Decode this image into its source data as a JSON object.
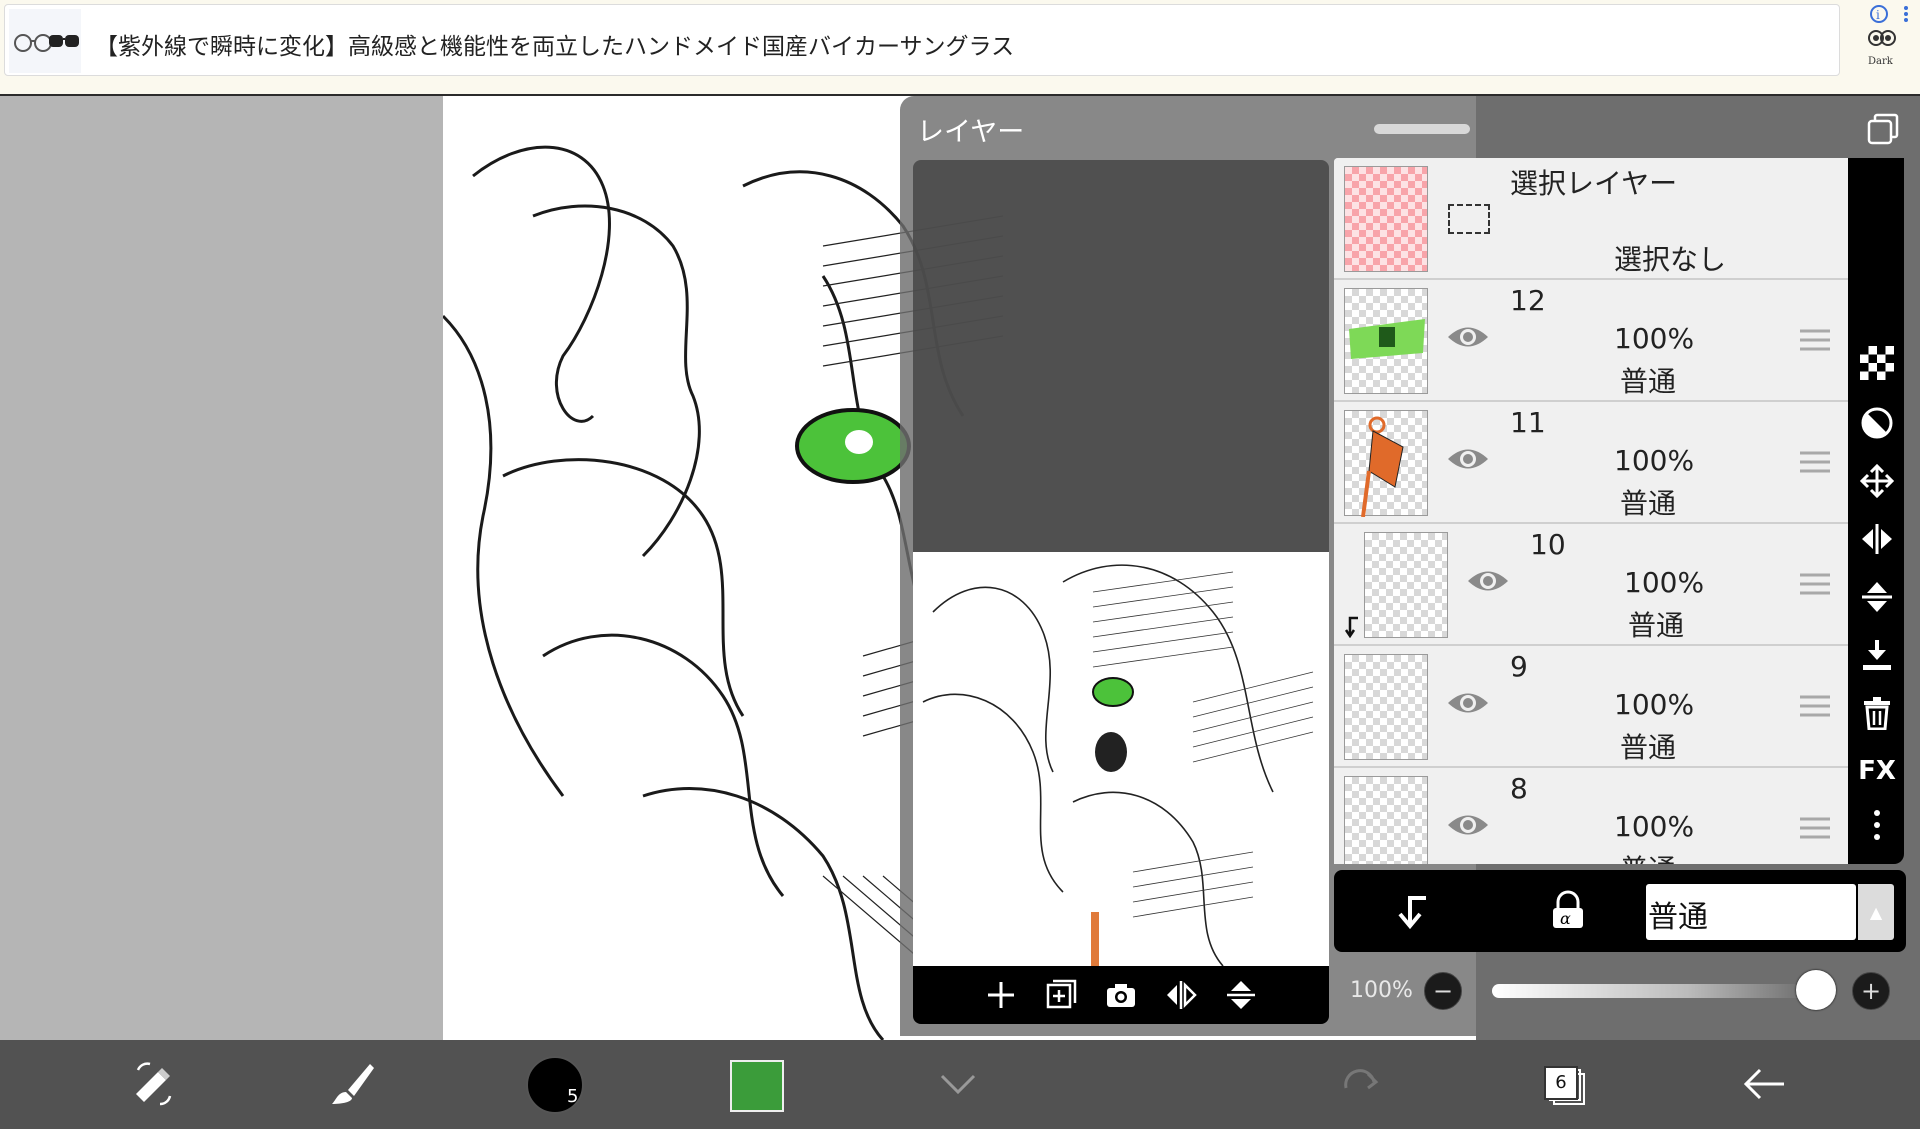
{
  "ad": {
    "text": "【紫外線で瞬時に変化】高級感と機能性を両立したハンドメイド国産バイカーサングラス",
    "side_label": "Dark"
  },
  "layer_panel": {
    "title": "レイヤー",
    "selection_layer": {
      "title": "選択レイヤー",
      "status": "選択なし"
    },
    "layers": [
      {
        "name": "12",
        "opacity": "100%",
        "blend": "普通"
      },
      {
        "name": "11",
        "opacity": "100%",
        "blend": "普通"
      },
      {
        "name": "10",
        "opacity": "100%",
        "blend": "普通"
      },
      {
        "name": "9",
        "opacity": "100%",
        "blend": "普通"
      },
      {
        "name": "8",
        "opacity": "100%",
        "blend": "普通"
      }
    ],
    "blend_mode": "普通",
    "opacity_label": "100%",
    "opacity_value": 1.0,
    "right_toolbar_fx": "FX"
  },
  "bottom_bar": {
    "brush_size": "5",
    "color": "#3b9c3a",
    "layer_count": "6"
  }
}
